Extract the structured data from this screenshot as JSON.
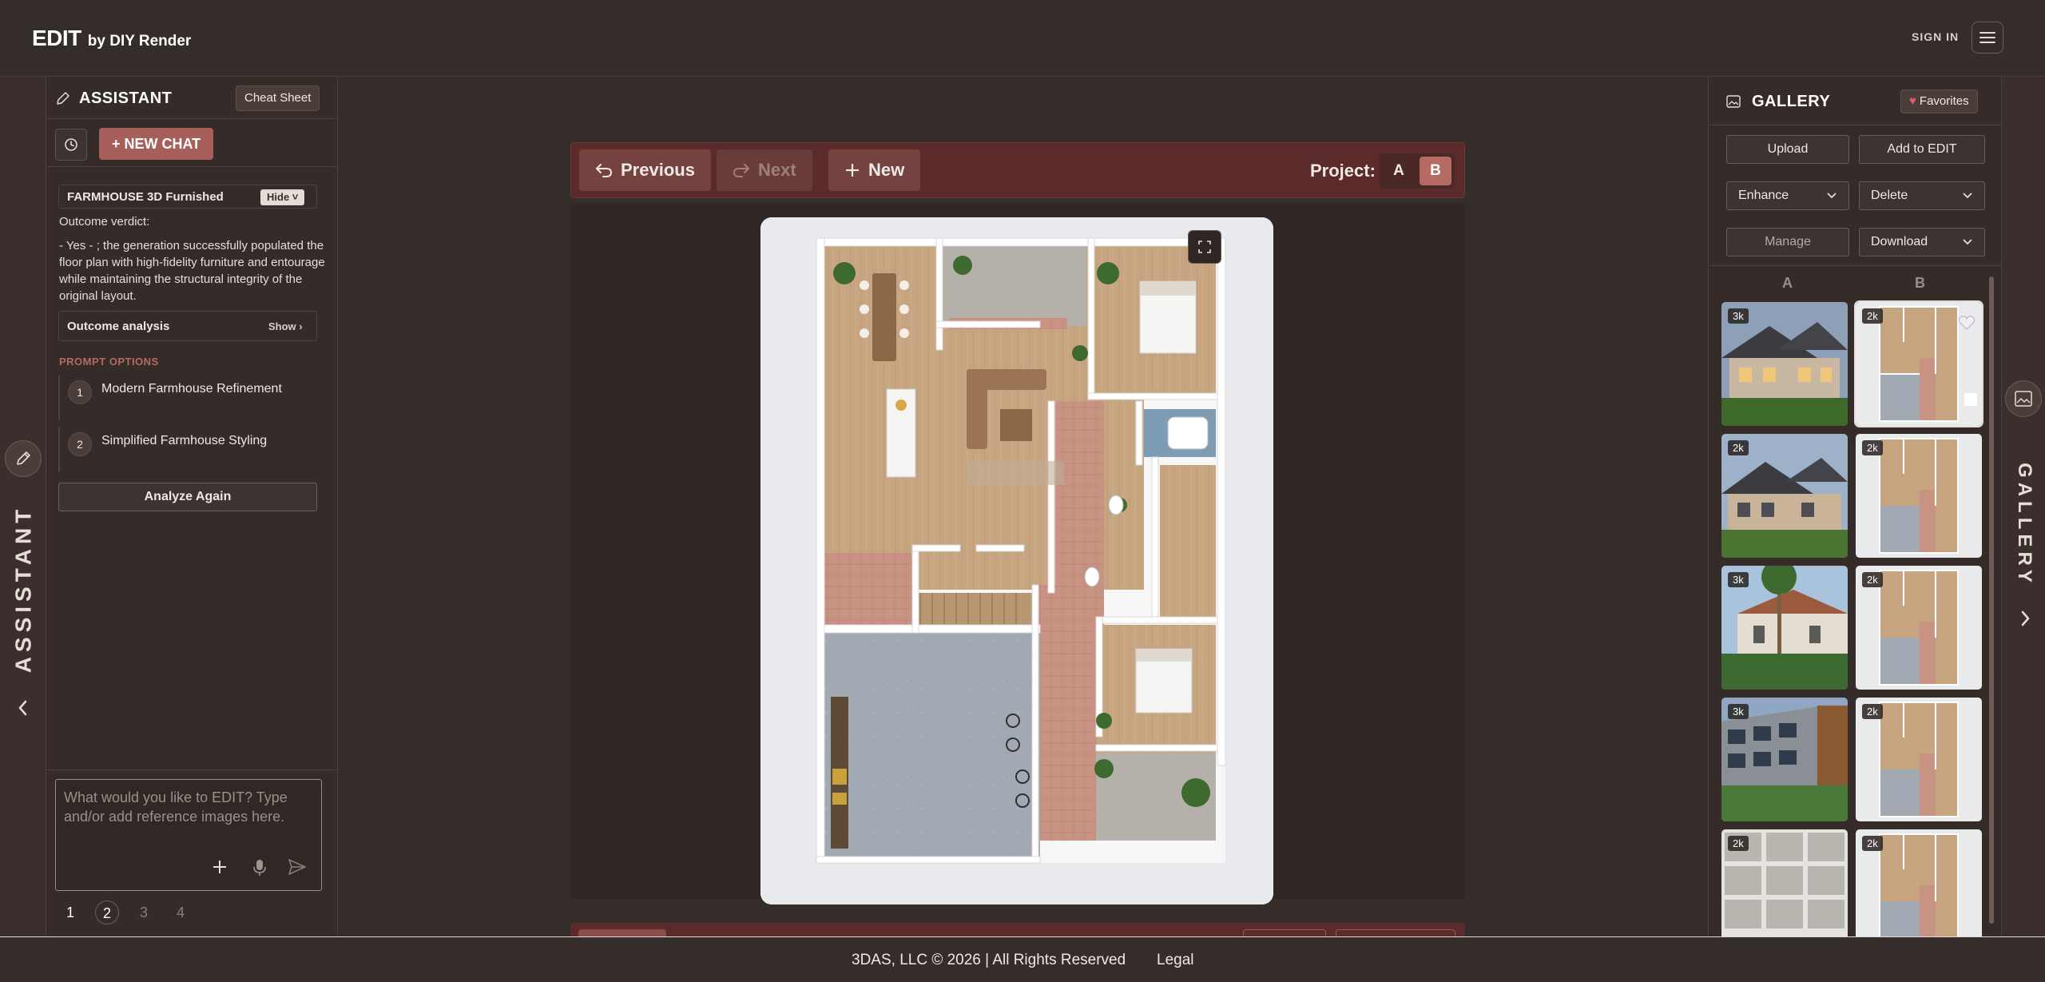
{
  "header": {
    "brand_main": "EDIT",
    "brand_sub": "by DIY Render",
    "sign_in": "SIGN IN"
  },
  "left_rail": {
    "label": "ASSISTANT"
  },
  "assistant": {
    "title": "ASSISTANT",
    "cheat_sheet": "Cheat Sheet",
    "new_chat": "+ NEW CHAT",
    "project_name": "FARMHOUSE 3D Furnished",
    "hide": "Hide",
    "verdict_label": "Outcome verdict:",
    "verdict_text": "- Yes - ; the generation successfully populated the floor plan with high-fidelity furniture and entourage while maintaining the structural integrity of the original layout.",
    "analysis_label": "Outcome analysis",
    "show": "Show",
    "prompt_options_head": "PROMPT OPTIONS",
    "options": [
      {
        "num": "1",
        "label": "Modern Farmhouse Refinement"
      },
      {
        "num": "2",
        "label": "Simplified Farmhouse Styling"
      }
    ],
    "analyze_again": "Analyze Again",
    "input_placeholder": "What would you like to EDIT? Type and/or add reference images here.",
    "pages": [
      "1",
      "2",
      "3",
      "4"
    ]
  },
  "toolbar": {
    "previous": "Previous",
    "next": "Next",
    "new": "New",
    "project_label": "Project:",
    "project_a": "A",
    "project_b": "B"
  },
  "gallery": {
    "title": "GALLERY",
    "favorites": "Favorites",
    "upload": "Upload",
    "add_to_edit": "Add to EDIT",
    "enhance": "Enhance",
    "delete": "Delete",
    "manage": "Manage",
    "download": "Download",
    "col_a": "A",
    "col_b": "B",
    "items_a": [
      {
        "badge": "3k",
        "kind": "house-dusk"
      },
      {
        "badge": "2k",
        "kind": "house-day"
      },
      {
        "badge": "3k",
        "kind": "house-palm"
      },
      {
        "badge": "3k",
        "kind": "building-modern"
      },
      {
        "badge": "2k",
        "kind": "kitchen-grid"
      }
    ],
    "items_b": [
      {
        "badge": "2k",
        "kind": "floorplan",
        "selected": true
      },
      {
        "badge": "2k",
        "kind": "floorplan"
      },
      {
        "badge": "2k",
        "kind": "floorplan"
      },
      {
        "badge": "2k",
        "kind": "floorplan"
      },
      {
        "badge": "2k",
        "kind": "floorplan"
      }
    ]
  },
  "right_rail": {
    "label": "GALLERY"
  },
  "footer": {
    "copyright": "3DAS, LLC © 2026 | All Rights Reserved",
    "legal": "Legal"
  },
  "colors": {
    "accent": "#a75f5b",
    "toolbar": "#5a2b2a",
    "background": "#342c29"
  }
}
